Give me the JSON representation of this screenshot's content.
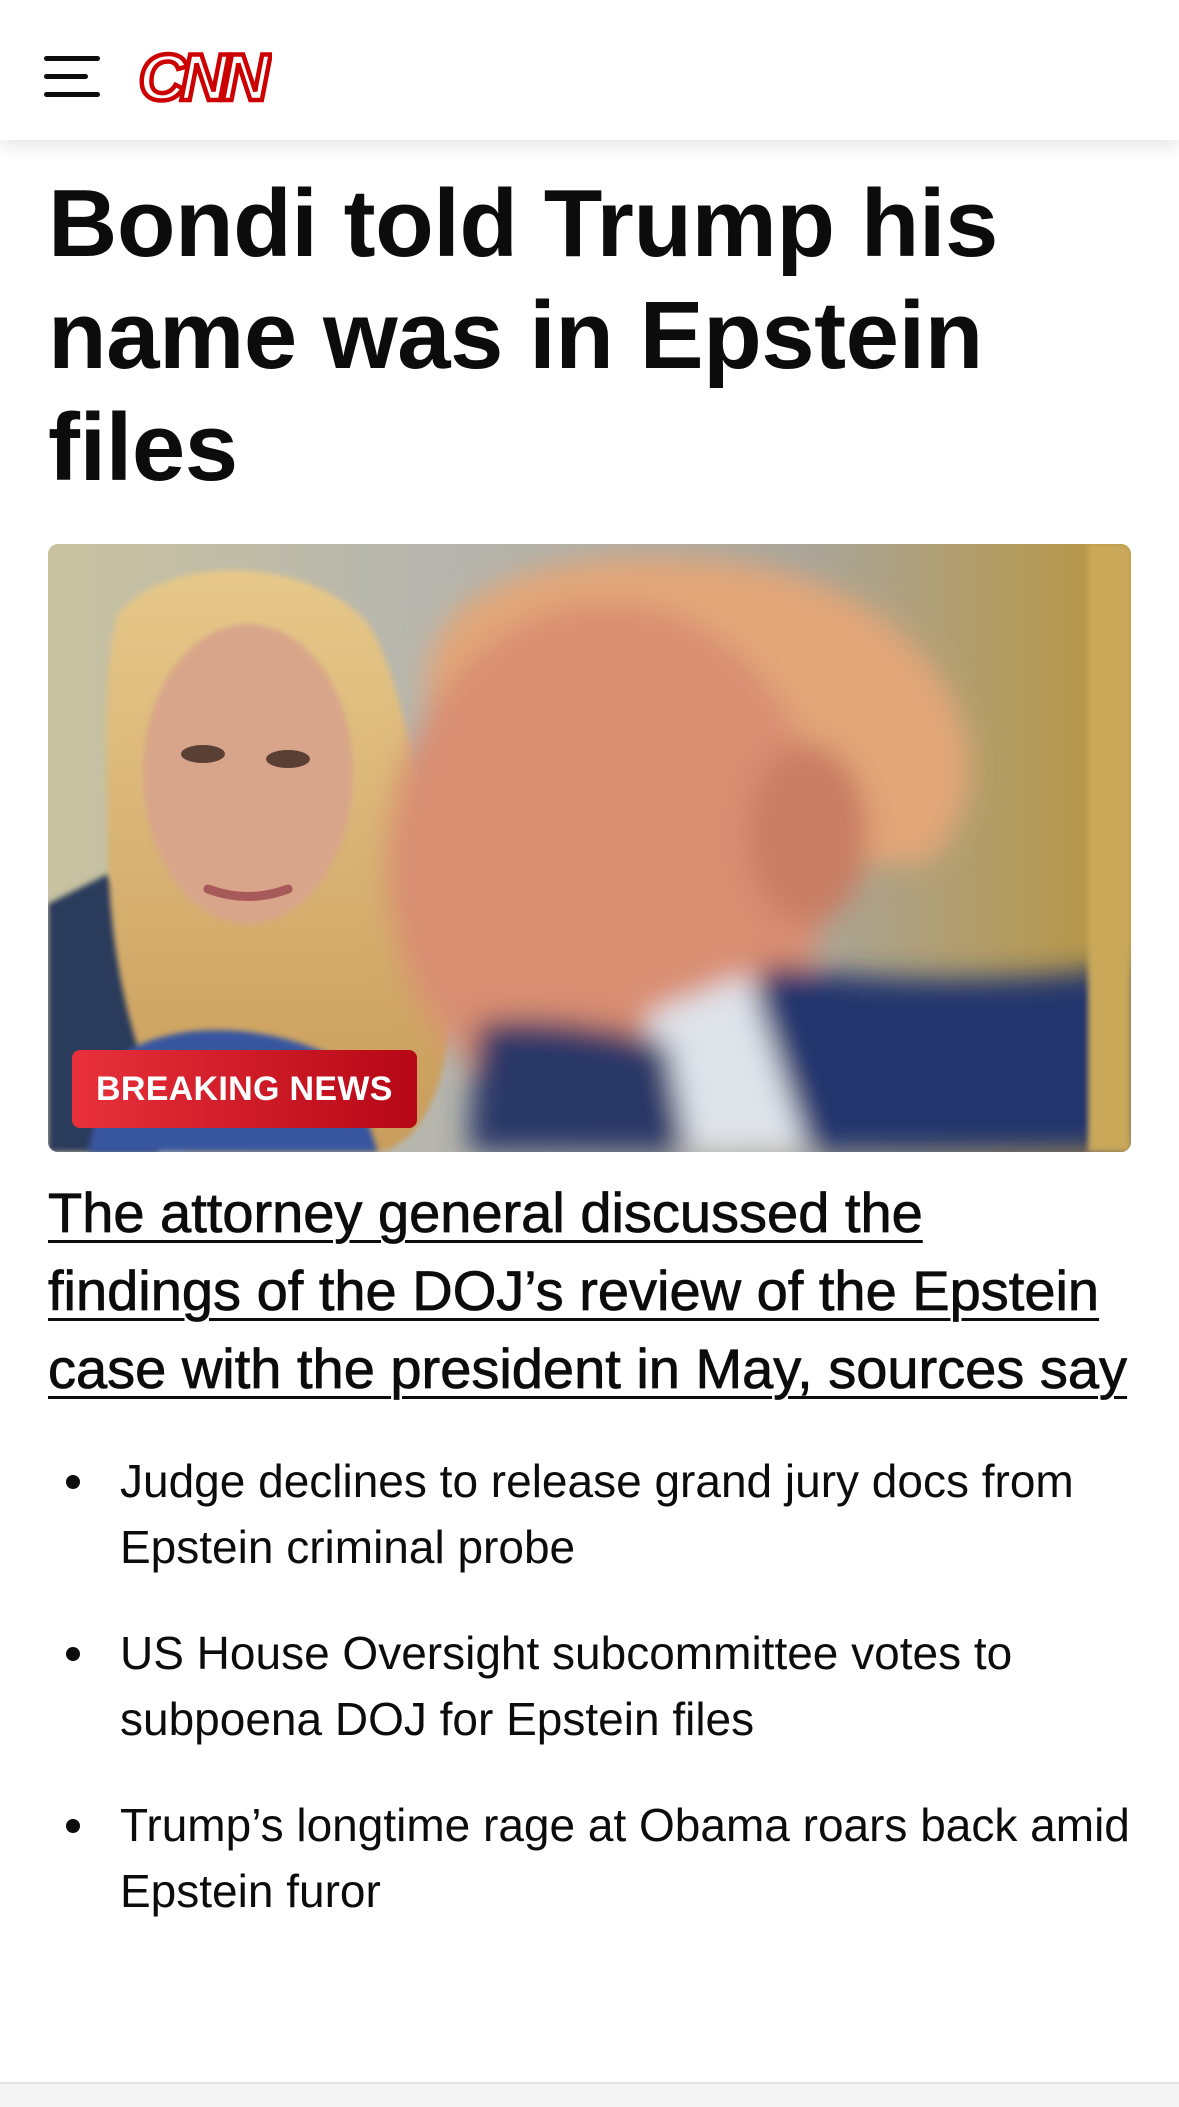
{
  "header": {
    "logo_text": "CNN",
    "brand_color": "#cc0000",
    "menu_icon": "hamburger-menu-icon"
  },
  "article": {
    "headline": "Bondi told Trump his name was in Epstein files",
    "hero_badge": "BREAKING NEWS",
    "badge_colors": [
      "#e8313b",
      "#b60716"
    ],
    "subheadline": "The attorney general discussed the findings of the DOJ’s review of the Epstein case with the president in May, sources say",
    "related": [
      "Judge declines to release grand jury docs from Epstein criminal probe",
      "US House Oversight subcommittee votes to subpoena DOJ for Epstein files",
      "Trump’s longtime rage at Obama roars back amid Epstein furor"
    ]
  }
}
